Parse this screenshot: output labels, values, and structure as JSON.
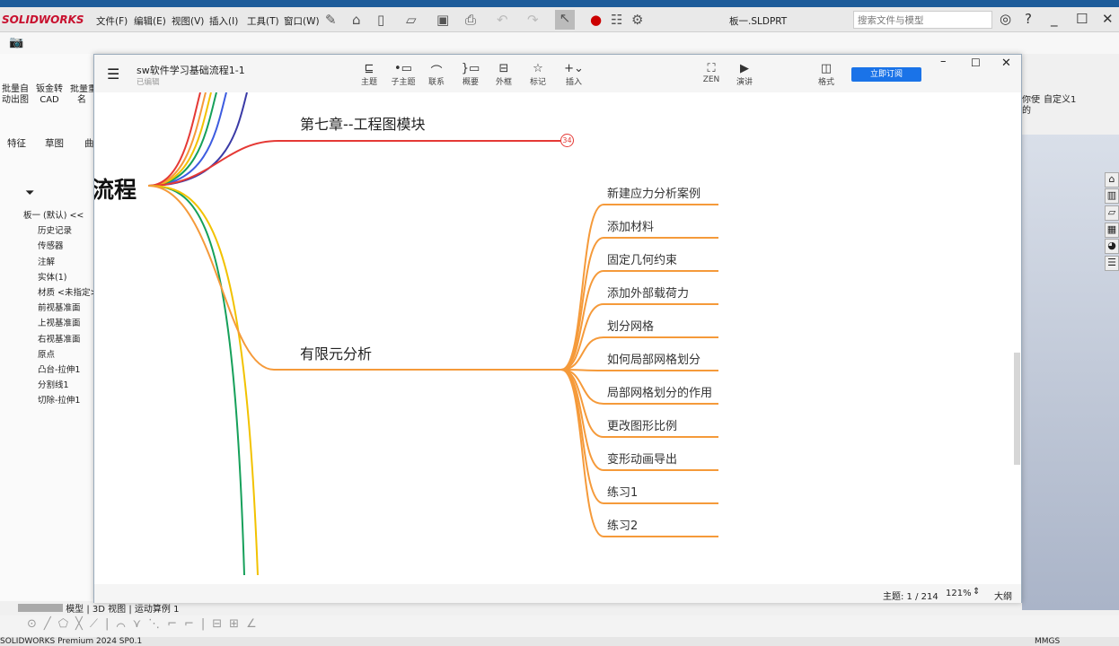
{
  "app": {
    "logo": "SOLIDWORKS",
    "doc_title": "板一.SLDPRT",
    "search_placeholder": "搜索文件与模型",
    "status": "SOLIDWORKS Premium 2024 SP0.1",
    "units": "MMGS"
  },
  "menu": [
    "文件(F)",
    "编辑(E)",
    "视图(V)",
    "插入(I)",
    "工具(T)",
    "窗口(W)"
  ],
  "commands": [
    {
      "label": "批量自\n动出图"
    },
    {
      "label": "钣金转\nCAD"
    },
    {
      "label": "批量重\n名"
    },
    {
      "label": "你使\n的"
    },
    {
      "label": "自定义1"
    }
  ],
  "cm_tabs": [
    "特征",
    "草图",
    "曲"
  ],
  "tree": [
    "板一 (默认) <<",
    "历史记录",
    "传感器",
    "注解",
    "实体(1)",
    "材质 <未指定>",
    "前视基准面",
    "上视基准面",
    "右视基准面",
    "原点",
    "凸台-拉伸1",
    "分割线1",
    "切除-拉伸1"
  ],
  "bottom_tabs": [
    "模型",
    "3D 视图",
    "运动算例 1"
  ],
  "mindmap": {
    "title": "sw软件学习基础流程1-1",
    "subtitle": "已编辑",
    "toolbar": [
      "主题",
      "子主题",
      "联系",
      "概要",
      "外框",
      "标记",
      "插入"
    ],
    "toolbar_right": [
      "ZEN",
      "演讲",
      "格式"
    ],
    "subscribe": "立即订阅",
    "root": "流程",
    "branch1": {
      "label": "第七章--工程图模块",
      "collapsed_count": "34"
    },
    "branch2": {
      "label": "有限元分析",
      "children": [
        "新建应力分析案例",
        "添加材料",
        "固定几何约束",
        "添加外部载荷力",
        "划分网格",
        "如何局部网格划分",
        "局部网格划分的作用",
        "更改图形比例",
        "变形动画导出",
        "练习1",
        "练习2"
      ]
    },
    "status": {
      "topic": "主题: 1 / 214",
      "zoom": "121%",
      "outline": "大纲"
    },
    "colors": {
      "red": "#e53935",
      "orange": "#f59a3a",
      "yellow": "#f2c200",
      "green": "#16a05a",
      "blue": "#3d5ce0",
      "indigo": "#3a3aa6"
    }
  }
}
